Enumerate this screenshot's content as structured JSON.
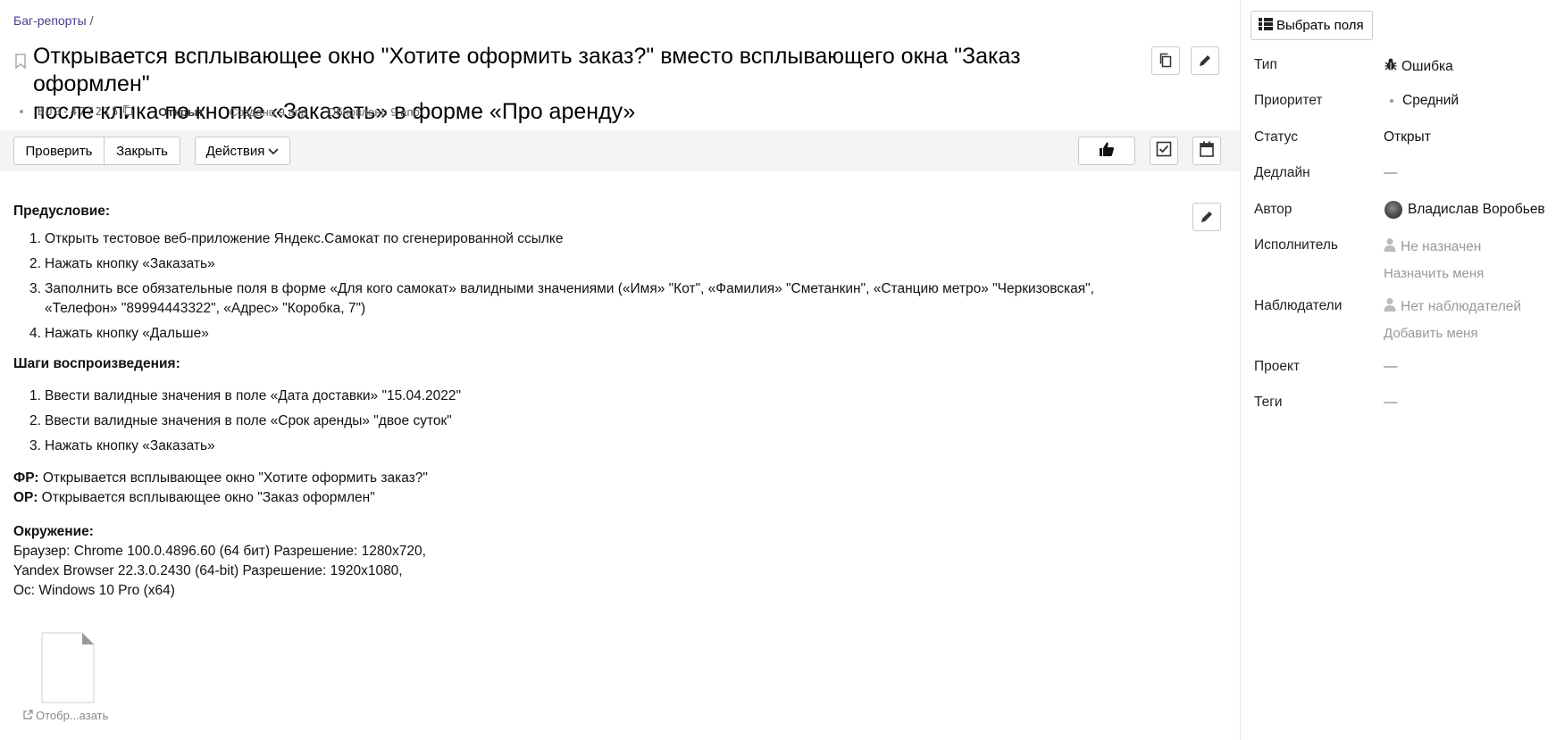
{
  "breadcrumb": {
    "parent": "Баг-репорты",
    "separator": "/"
  },
  "issue": {
    "title_line1": "Открывается всплывающее окно \"Хотите оформить заказ?\" вместо всплывающего окна \"Заказ оформлен\"",
    "title_line2": "после клика по кнопке «Заказать» в форме «Про аренду»",
    "key": "BUG-477215",
    "status": "Открыт",
    "created": "Создано 9 апр",
    "updated": "Обновлено 9 апр"
  },
  "toolbar": {
    "check_label": "Проверить",
    "close_label": "Закрыть",
    "actions_label": "Действия"
  },
  "description": {
    "precondition_title": "Предусловие:",
    "precondition_steps": [
      {
        "num": "1.",
        "text": "Открыть тестовое веб-приложение Яндекс.Самокат по сгенерированной ссылке"
      },
      {
        "num": "2.",
        "text": "Нажать кнопку «Заказать»"
      },
      {
        "num": "3.",
        "text": "Заполнить все обязательные поля в форме «Для кого самокат» валидными значениями («Имя» \"Кот\", «Фамилия» \"Сметанкин\", «Станцию метро» \"Черкизовская\", «Телефон» \"89994443322\", «Адрес» \"Коробка, 7\")"
      },
      {
        "num": "4.",
        "text": "Нажать кнопку «Дальше»"
      }
    ],
    "steps_title": "Шаги воспроизведения:",
    "steps": [
      {
        "num": "1.",
        "text": "Ввести валидные значения в поле «Дата доставки» \"15.04.2022\""
      },
      {
        "num": "2.",
        "text": "Ввести валидные значения в поле «Срок аренды» \"двое суток\""
      },
      {
        "num": "3.",
        "text": "Нажать кнопку «Заказать»"
      }
    ],
    "fr_label": "ФР:",
    "fr_text": "Открывается всплывающее окно \"Хотите оформить заказ?\"",
    "or_label": "ОР:",
    "or_text": "Открывается всплывающее окно \"Заказ оформлен\"",
    "env_title": "Окружение:",
    "env_lines": [
      "Браузер: Chrome 100.0.4896.60 (64 бит) Разрешение: 1280x720,",
      "Yandex Browser 22.3.0.2430 (64-bit) Разрешение: 1920x1080,",
      "Ос: Windows 10 Pro (x64)"
    ]
  },
  "attachment": {
    "label": "Отобр...азать",
    "icon": "file-icon"
  },
  "sidebar": {
    "pick_fields_label": "Выбрать поля",
    "type_label": "Тип",
    "type_value": "Ошибка",
    "priority_label": "Приоритет",
    "priority_value": "Средний",
    "status_label": "Статус",
    "status_value": "Открыт",
    "deadline_label": "Дедлайн",
    "deadline_value": "—",
    "author_label": "Автор",
    "author_value": "Владислав Воробьев",
    "assignee_label": "Исполнитель",
    "assignee_value": "Не назначен",
    "assign_me": "Назначить меня",
    "followers_label": "Наблюдатели",
    "followers_value": "Нет наблюдателей",
    "add_me": "Добавить меня",
    "project_label": "Проект",
    "project_value": "—",
    "tags_label": "Теги",
    "tags_value": "—"
  }
}
